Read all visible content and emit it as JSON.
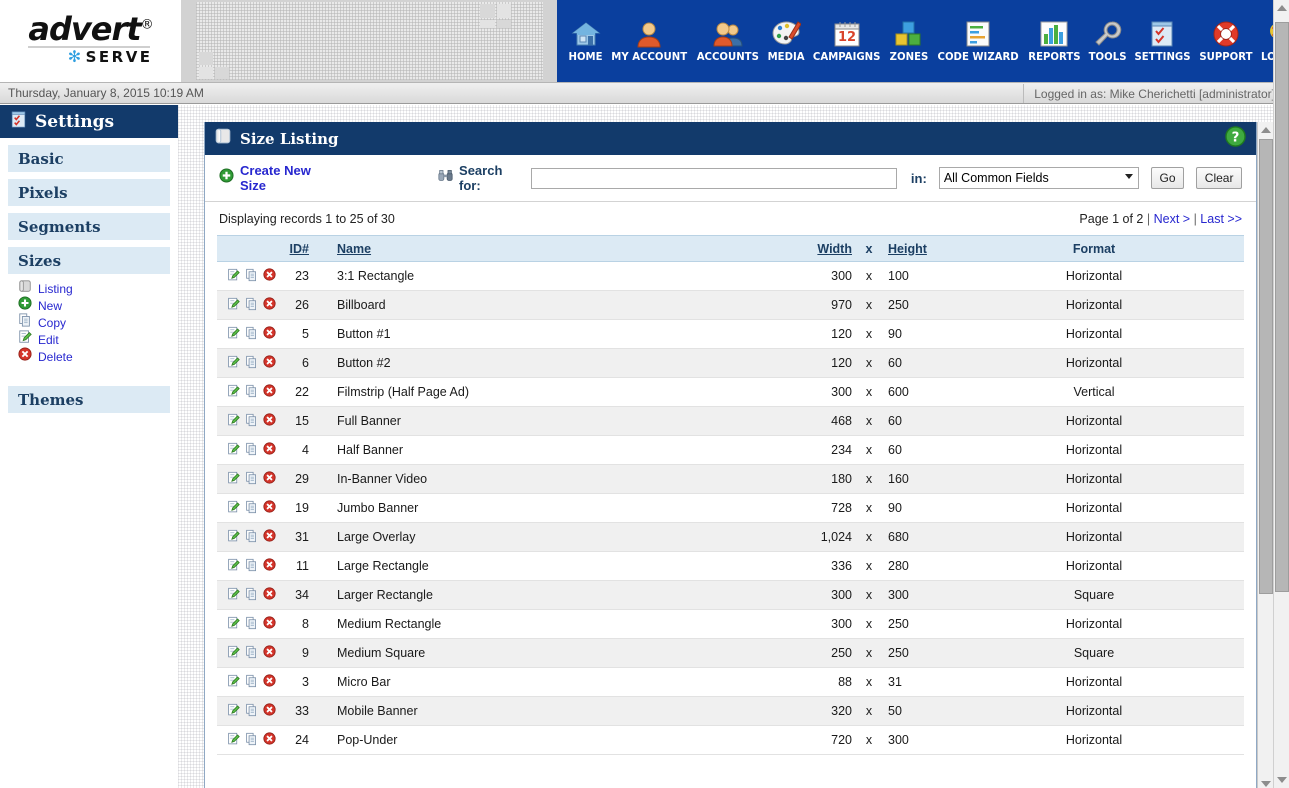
{
  "brand": {
    "logo_top": "advert",
    "logo_reg": "®",
    "logo_bottom": "SERVE",
    "star": "✻"
  },
  "nav": {
    "items": [
      {
        "label": "HOME",
        "icon": "home-icon"
      },
      {
        "label": "MY ACCOUNT",
        "icon": "user-icon"
      },
      {
        "label": "ACCOUNTS",
        "icon": "users-icon"
      },
      {
        "label": "MEDIA",
        "icon": "palette-icon"
      },
      {
        "label": "CAMPAIGNS",
        "icon": "calendar-icon"
      },
      {
        "label": "ZONES",
        "icon": "blocks-icon"
      },
      {
        "label": "CODE WIZARD",
        "icon": "code-wizard-icon"
      },
      {
        "label": "REPORTS",
        "icon": "bar-chart-icon"
      },
      {
        "label": "TOOLS",
        "icon": "wrench-icon"
      },
      {
        "label": "SETTINGS",
        "icon": "checklist-icon"
      },
      {
        "label": "SUPPORT",
        "icon": "lifebuoy-icon"
      },
      {
        "label": "LOGOUT",
        "icon": "key-icon"
      }
    ]
  },
  "statusbar": {
    "date": "Thursday, January 8, 2015 10:19 AM",
    "login": "Logged in as: Mike Cherichetti [administrator]"
  },
  "sidebar": {
    "header": "Settings",
    "header_icon": "checklist-icon",
    "sections": [
      {
        "label": "Basic"
      },
      {
        "label": "Pixels"
      },
      {
        "label": "Segments"
      },
      {
        "label": "Sizes"
      }
    ],
    "sub_items": [
      {
        "label": "Listing",
        "icon": "scroll-icon"
      },
      {
        "label": "New",
        "icon": "plus-circle-icon"
      },
      {
        "label": "Copy",
        "icon": "copy-icon"
      },
      {
        "label": "Edit",
        "icon": "edit-icon"
      },
      {
        "label": "Delete",
        "icon": "delete-icon"
      }
    ],
    "footer_section": {
      "label": "Themes"
    }
  },
  "panel": {
    "title": "Size Listing",
    "title_icon": "scroll-icon",
    "help_icon": "help-icon"
  },
  "toolbar": {
    "create_label": "Create New Size",
    "create_icon": "plus-circle-icon",
    "search_icon": "binoculars-icon",
    "search_label": "Search for:",
    "search_value": "",
    "search_placeholder": "",
    "in_label": "in:",
    "scope_selected": "All Common Fields",
    "scope_options": [
      "All Common Fields"
    ],
    "go_label": "Go",
    "clear_label": "Clear"
  },
  "records": {
    "summary": "Displaying records 1 to 25 of 30",
    "page_label": "Page 1 of 2",
    "next_label": "Next >",
    "last_label": "Last >>",
    "separator": "|"
  },
  "table": {
    "columns": {
      "id": "ID#",
      "name": "Name",
      "width": "Width",
      "x": "x",
      "height": "Height",
      "format": "Format"
    },
    "row_action_icons": [
      "edit-icon",
      "copy-icon",
      "delete-icon"
    ],
    "rows": [
      {
        "id": "23",
        "name": "3:1 Rectangle",
        "width": "300",
        "x": "x",
        "height": "100",
        "format": "Horizontal"
      },
      {
        "id": "26",
        "name": "Billboard",
        "width": "970",
        "x": "x",
        "height": "250",
        "format": "Horizontal"
      },
      {
        "id": "5",
        "name": "Button #1",
        "width": "120",
        "x": "x",
        "height": "90",
        "format": "Horizontal"
      },
      {
        "id": "6",
        "name": "Button #2",
        "width": "120",
        "x": "x",
        "height": "60",
        "format": "Horizontal"
      },
      {
        "id": "22",
        "name": "Filmstrip (Half Page Ad)",
        "width": "300",
        "x": "x",
        "height": "600",
        "format": "Vertical"
      },
      {
        "id": "15",
        "name": "Full Banner",
        "width": "468",
        "x": "x",
        "height": "60",
        "format": "Horizontal"
      },
      {
        "id": "4",
        "name": "Half Banner",
        "width": "234",
        "x": "x",
        "height": "60",
        "format": "Horizontal"
      },
      {
        "id": "29",
        "name": "In-Banner Video",
        "width": "180",
        "x": "x",
        "height": "160",
        "format": "Horizontal"
      },
      {
        "id": "19",
        "name": "Jumbo Banner",
        "width": "728",
        "x": "x",
        "height": "90",
        "format": "Horizontal"
      },
      {
        "id": "31",
        "name": "Large Overlay",
        "width": "1,024",
        "x": "x",
        "height": "680",
        "format": "Horizontal"
      },
      {
        "id": "11",
        "name": "Large Rectangle",
        "width": "336",
        "x": "x",
        "height": "280",
        "format": "Horizontal"
      },
      {
        "id": "34",
        "name": "Larger Rectangle",
        "width": "300",
        "x": "x",
        "height": "300",
        "format": "Square"
      },
      {
        "id": "8",
        "name": "Medium Rectangle",
        "width": "300",
        "x": "x",
        "height": "250",
        "format": "Horizontal"
      },
      {
        "id": "9",
        "name": "Medium Square",
        "width": "250",
        "x": "x",
        "height": "250",
        "format": "Square"
      },
      {
        "id": "3",
        "name": "Micro Bar",
        "width": "88",
        "x": "x",
        "height": "31",
        "format": "Horizontal"
      },
      {
        "id": "33",
        "name": "Mobile Banner",
        "width": "320",
        "x": "x",
        "height": "50",
        "format": "Horizontal"
      },
      {
        "id": "24",
        "name": "Pop-Under",
        "width": "720",
        "x": "x",
        "height": "300",
        "format": "Horizontal"
      }
    ]
  },
  "colors": {
    "nav_blue": "#0a3f9e",
    "header_blue": "#123a6b",
    "section_blue": "#dceaf4",
    "link_blue": "#2727cf",
    "alt_row": "#f0f0f0"
  }
}
